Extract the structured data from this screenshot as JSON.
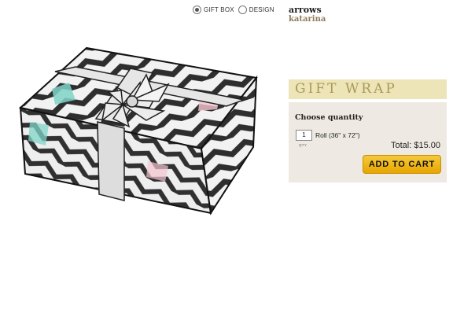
{
  "view_toggle": {
    "options": [
      {
        "label": "GIFT BOX",
        "selected": true
      },
      {
        "label": "DESIGN",
        "selected": false
      }
    ]
  },
  "product": {
    "name": "arrows",
    "designer": "katarina"
  },
  "section_title": "GIFT WRAP",
  "purchase": {
    "choose_label": "Choose quantity",
    "quantity_value": "1",
    "quantity_caption": "QTY",
    "roll_label": "Roll (36\" x 72\")",
    "total_label": "Total: $15.00",
    "add_to_cart_label": "ADD TO CART"
  },
  "colors": {
    "heading_band": "#ede4b8",
    "heading_text": "#a89a5a",
    "panel_bg": "#eeeae3",
    "button_yellow": "#f2b718",
    "designer_text": "#8d7c5c",
    "wrap_teal": "#7fd4c8",
    "wrap_pink": "#f4c6cf"
  }
}
